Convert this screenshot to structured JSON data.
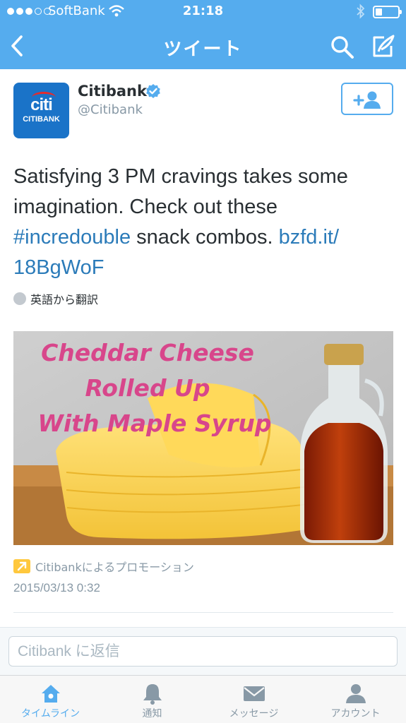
{
  "status_bar": {
    "carrier": "SoftBank",
    "time": "21:18",
    "signal_bars_filled": 3,
    "signal_bars_total": 5,
    "battery_level": 0.25
  },
  "nav": {
    "title": "ツイート",
    "back_icon": "chevron-left-icon",
    "search_icon": "search-icon",
    "compose_icon": "compose-icon"
  },
  "tweet": {
    "author_name": "Citibank",
    "author_handle": "@Citibank",
    "verified": true,
    "avatar_text": "citi",
    "avatar_subtext": "CITIBANK",
    "text_part1": "Satisfying 3 PM cravings takes some imagination. Check out these ",
    "hashtag": "#incredouble",
    "text_part2": " snack combos. ",
    "link": "bzfd.it/​18BgWoF",
    "translate_label": "英語から翻訳",
    "media_caption_lines": [
      "Cheddar Cheese",
      "Rolled Up",
      "With Maple Syrup"
    ],
    "promo_label": "Citibankによるプロモーション",
    "timestamp": "2015/03/13 0:32"
  },
  "reply": {
    "placeholder": "Citibank に返信"
  },
  "tabbar": {
    "items": [
      {
        "label": "タイムライン",
        "icon": "home-icon",
        "active": true
      },
      {
        "label": "通知",
        "icon": "bell-icon",
        "active": false
      },
      {
        "label": "メッセージ",
        "icon": "envelope-icon",
        "active": false
      },
      {
        "label": "アカウント",
        "icon": "person-icon",
        "active": false
      }
    ]
  },
  "colors": {
    "brand": "#55acee",
    "link": "#2b7bb9",
    "muted": "#8899a6",
    "promo": "#ffc83d"
  }
}
